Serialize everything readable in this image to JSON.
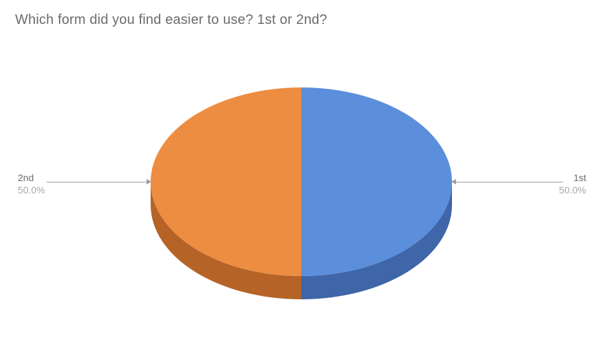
{
  "title": "Which form did you find easier to use? 1st or 2nd?",
  "labels": {
    "left": {
      "name": "2nd",
      "pct": "50.0%"
    },
    "right": {
      "name": "1st",
      "pct": "50.0%"
    }
  },
  "chart_data": {
    "type": "pie",
    "title": "Which form did you find easier to use? 1st or 2nd?",
    "series": [
      {
        "name": "1st",
        "value": 50.0,
        "percent_label": "50.0%",
        "color": "#5B8EDB"
      },
      {
        "name": "2nd",
        "value": 50.0,
        "percent_label": "50.0%",
        "color": "#ED8D42"
      }
    ],
    "style": "3d",
    "legend": "callout-labels"
  }
}
